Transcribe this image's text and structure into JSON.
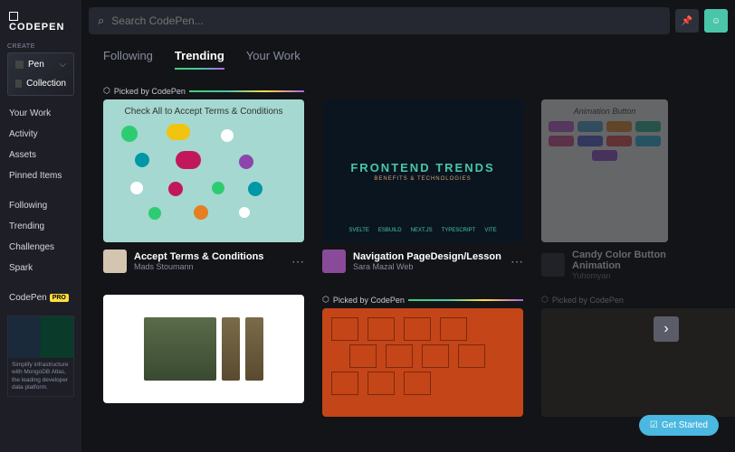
{
  "logo": "CODEPEN",
  "search": {
    "placeholder": "Search CodePen..."
  },
  "sidebar": {
    "create_label": "CREATE",
    "pen": "Pen",
    "collection": "Collection",
    "nav": [
      "Your Work",
      "Activity",
      "Assets",
      "Pinned Items"
    ],
    "nav2": [
      "Following",
      "Trending",
      "Challenges",
      "Spark"
    ],
    "pro_label": "CodePen",
    "pro_badge": "PRO",
    "promo_text": "Simplify infrastructure with MongoDB Atlas, the leading developer data platform."
  },
  "tabs": [
    "Following",
    "Trending",
    "Your Work"
  ],
  "active_tab": 1,
  "picked_label": "Picked by CodePen",
  "cards": [
    {
      "thumb_title": "Check All to Accept Terms & Conditions",
      "title": "Accept Terms & Conditions",
      "author": "Mads Stoumann"
    },
    {
      "thumb_title": "FRONTEND TRENDS",
      "thumb_sub": "BENEFITS & TECHNOLOGIES",
      "tags": [
        "SVELTE",
        "ESBUILD",
        "NEXT.JS",
        "TYPESCRIPT",
        "VITE"
      ],
      "title": "Navigation PageDesign/Lesson",
      "author": "Sara Mazal Web"
    },
    {
      "thumb_title": "Animation Button",
      "title": "Candy Color Button Animation",
      "author": "Yuhomyan"
    }
  ],
  "colors": {
    "accent": "#4ac5a8",
    "pro": "#ffdd40",
    "cta": "#4ab8e0"
  },
  "cta": "Get Started"
}
